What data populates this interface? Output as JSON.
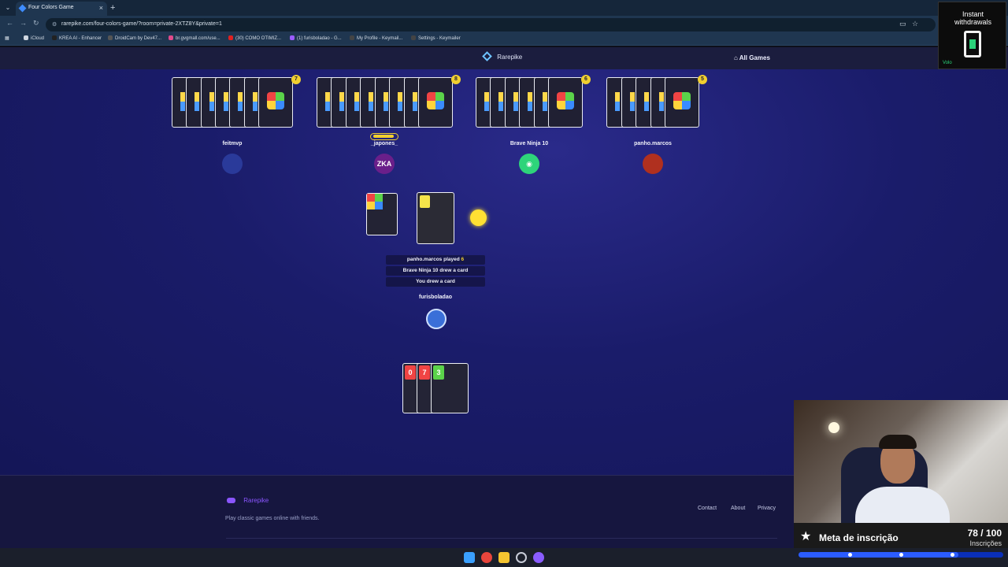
{
  "browser": {
    "tab_title": "Four Colors Game",
    "tab_close": "×",
    "new_tab": "+",
    "url": "rarepike.com/four-colors-game/?room=private-2XTZ8Y&private=1",
    "bookmarks": [
      {
        "label": "iCloud",
        "color": "#cfd6e0"
      },
      {
        "label": "KREA AI - Enhancer",
        "color": "#222222"
      },
      {
        "label": "DroidCam by Dev47...",
        "color": "#555555"
      },
      {
        "label": "br.gvgmall.com/use...",
        "color": "#e04a8a"
      },
      {
        "label": "(30) COMO OTIMIZ...",
        "color": "#e02020"
      },
      {
        "label": "(1) furisboladao - G...",
        "color": "#9b5cff"
      },
      {
        "label": "My Profile - Keymail...",
        "color": "#444444"
      },
      {
        "label": "Settings - Keymailer",
        "color": "#444444"
      }
    ]
  },
  "site": {
    "brand": "Rarepike",
    "all_games": "All Games"
  },
  "opponents": [
    {
      "name": "feitmvp",
      "count": "7",
      "cards": 7,
      "avatar_color": "#2a3a9a"
    },
    {
      "name": "_japones_",
      "count": "8",
      "cards": 8,
      "avatar_color": "#6a1f8a",
      "avatar_text": "ZKA",
      "active": true
    },
    {
      "name": "Brave Ninja 10",
      "count": "6",
      "cards": 6,
      "avatar_color": "#2ed47a",
      "avatar_text": "◉"
    },
    {
      "name": "panho.marcos",
      "count": "5",
      "cards": 5,
      "avatar_color": "#b0301f"
    }
  ],
  "colors": {
    "red": "#f04444",
    "green": "#5bd34a",
    "blue": "#3a8bff",
    "yellow": "#ffd43b",
    "current_color": "#ffe033"
  },
  "log": [
    {
      "prefix": "panho.marcos played ",
      "highlight": "6"
    },
    {
      "prefix": "Brave Ninja 10 drew a card",
      "highlight": ""
    },
    {
      "prefix": "You drew a card",
      "highlight": ""
    }
  ],
  "player": {
    "name": "furisboladao",
    "hand": [
      {
        "value": "0",
        "color": "#f04444"
      },
      {
        "value": "7",
        "color": "#f04444"
      },
      {
        "value": "3",
        "color": "#5bd34a"
      }
    ]
  },
  "footer": {
    "brand": "Rarepike",
    "tagline": "Play classic games online with friends.",
    "links": [
      "Contact",
      "About",
      "Privacy"
    ]
  },
  "overlay": {
    "promo_line1": "Instant",
    "promo_line2": "withdrawals",
    "promo_tag": "Volo",
    "goal_label": "Meta de inscrição",
    "goal_count": "78 / 100",
    "goal_sub": "Inscrições",
    "goal_progress": 0.78
  }
}
